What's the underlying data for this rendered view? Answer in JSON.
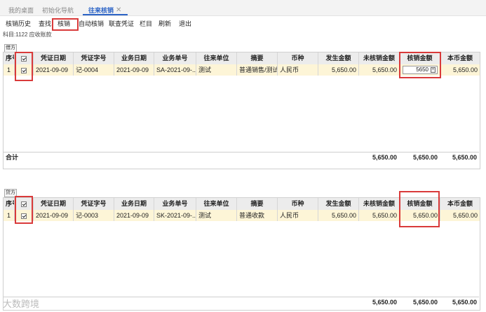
{
  "tabs": [
    {
      "label": "我的桌面",
      "active": false
    },
    {
      "label": "初始化导航",
      "active": false
    },
    {
      "label": "往来核销",
      "active": true
    }
  ],
  "toolbar": [
    "核销历史",
    "查找",
    "核销",
    "自动核销",
    "联查凭证",
    "栏目",
    "刷新",
    "退出"
  ],
  "subject": "科目:1122 应收账款",
  "columns": [
    "序号",
    "",
    "凭证日期",
    "凭证字号",
    "业务日期",
    "业务单号",
    "往来单位",
    "摘要",
    "币种",
    "发生金额",
    "未核销金额",
    "核销金额",
    "本币金额"
  ],
  "debit": {
    "label": "借方",
    "rows": [
      {
        "idx": "1",
        "date": "2021-09-09",
        "voucher": "记-0004",
        "biz_date": "2021-09-09",
        "biz_no": "SA-2021-09-...",
        "partner": "测试",
        "summary": "普通销售/测试",
        "currency": "人民币",
        "amount": "5,650.00",
        "unsettled": "5,650.00",
        "settle": "5650",
        "base": "5,650.00"
      }
    ],
    "total_label": "合计",
    "totals": {
      "unsettled": "5,650.00",
      "settle": "5,650.00",
      "base": "5,650.00"
    }
  },
  "credit": {
    "label": "贷方",
    "rows": [
      {
        "idx": "1",
        "date": "2021-09-09",
        "voucher": "记-0003",
        "biz_date": "2021-09-09",
        "biz_no": "SK-2021-09-...",
        "partner": "测试",
        "summary": "普通收款",
        "currency": "人民币",
        "amount": "5,650.00",
        "unsettled": "5,650.00",
        "settle": "5,650.00",
        "base": "5,650.00"
      }
    ],
    "totals": {
      "unsettled": "5,650.00",
      "settle": "5,650.00",
      "base": "5,650.00"
    }
  },
  "watermark": "大数跨境",
  "colors": {
    "accent": "#2b63c6",
    "highlight_row": "#fdf5d7",
    "annotation_red": "#d93a3a"
  }
}
